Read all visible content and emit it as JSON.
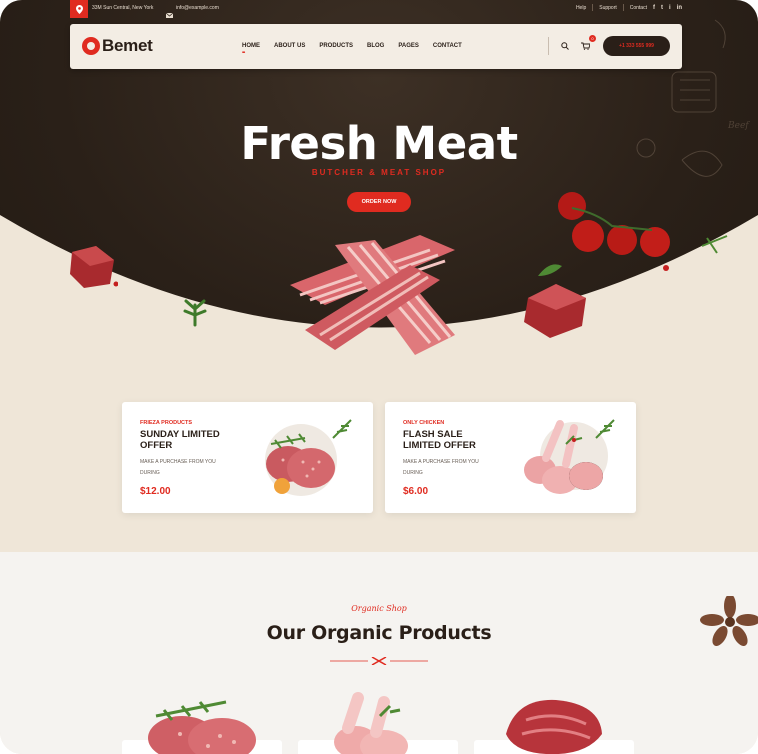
{
  "topbar": {
    "address": "33M Sun Central, New York",
    "email": "info@example.com",
    "links": [
      "Help",
      "Support",
      "Contact"
    ],
    "social": [
      "f",
      "t",
      "i",
      "in"
    ]
  },
  "nav": {
    "logo": "Bemet",
    "menu": [
      "HOME",
      "ABOUT US",
      "PRODUCTS",
      "BLOG",
      "PAGES",
      "CONTACT"
    ],
    "cart_count": "0",
    "phone": "+1 333 555 999"
  },
  "hero": {
    "title": "Fresh Meat",
    "subtitle": "BUTCHER & MEAT SHOP",
    "cta": "ORDER NOW"
  },
  "offers": [
    {
      "tag": "FRIEZA PRODUCTS",
      "title": "SUNDAY LIMITED OFFER",
      "desc": "MAKE A PURCHASE FROM YOU DURING",
      "price": "$12.00"
    },
    {
      "tag": "ONLY CHICKEN",
      "title": "FLASH SALE LIMITED OFFER",
      "desc": "MAKE A PURCHASE FROM YOU DURING",
      "price": "$6.00"
    }
  ],
  "products_section": {
    "script": "Organic Shop",
    "title": "Our Organic Products"
  },
  "colors": {
    "accent": "#e02b20",
    "dark": "#2a1f18",
    "cream": "#efe6d8"
  }
}
